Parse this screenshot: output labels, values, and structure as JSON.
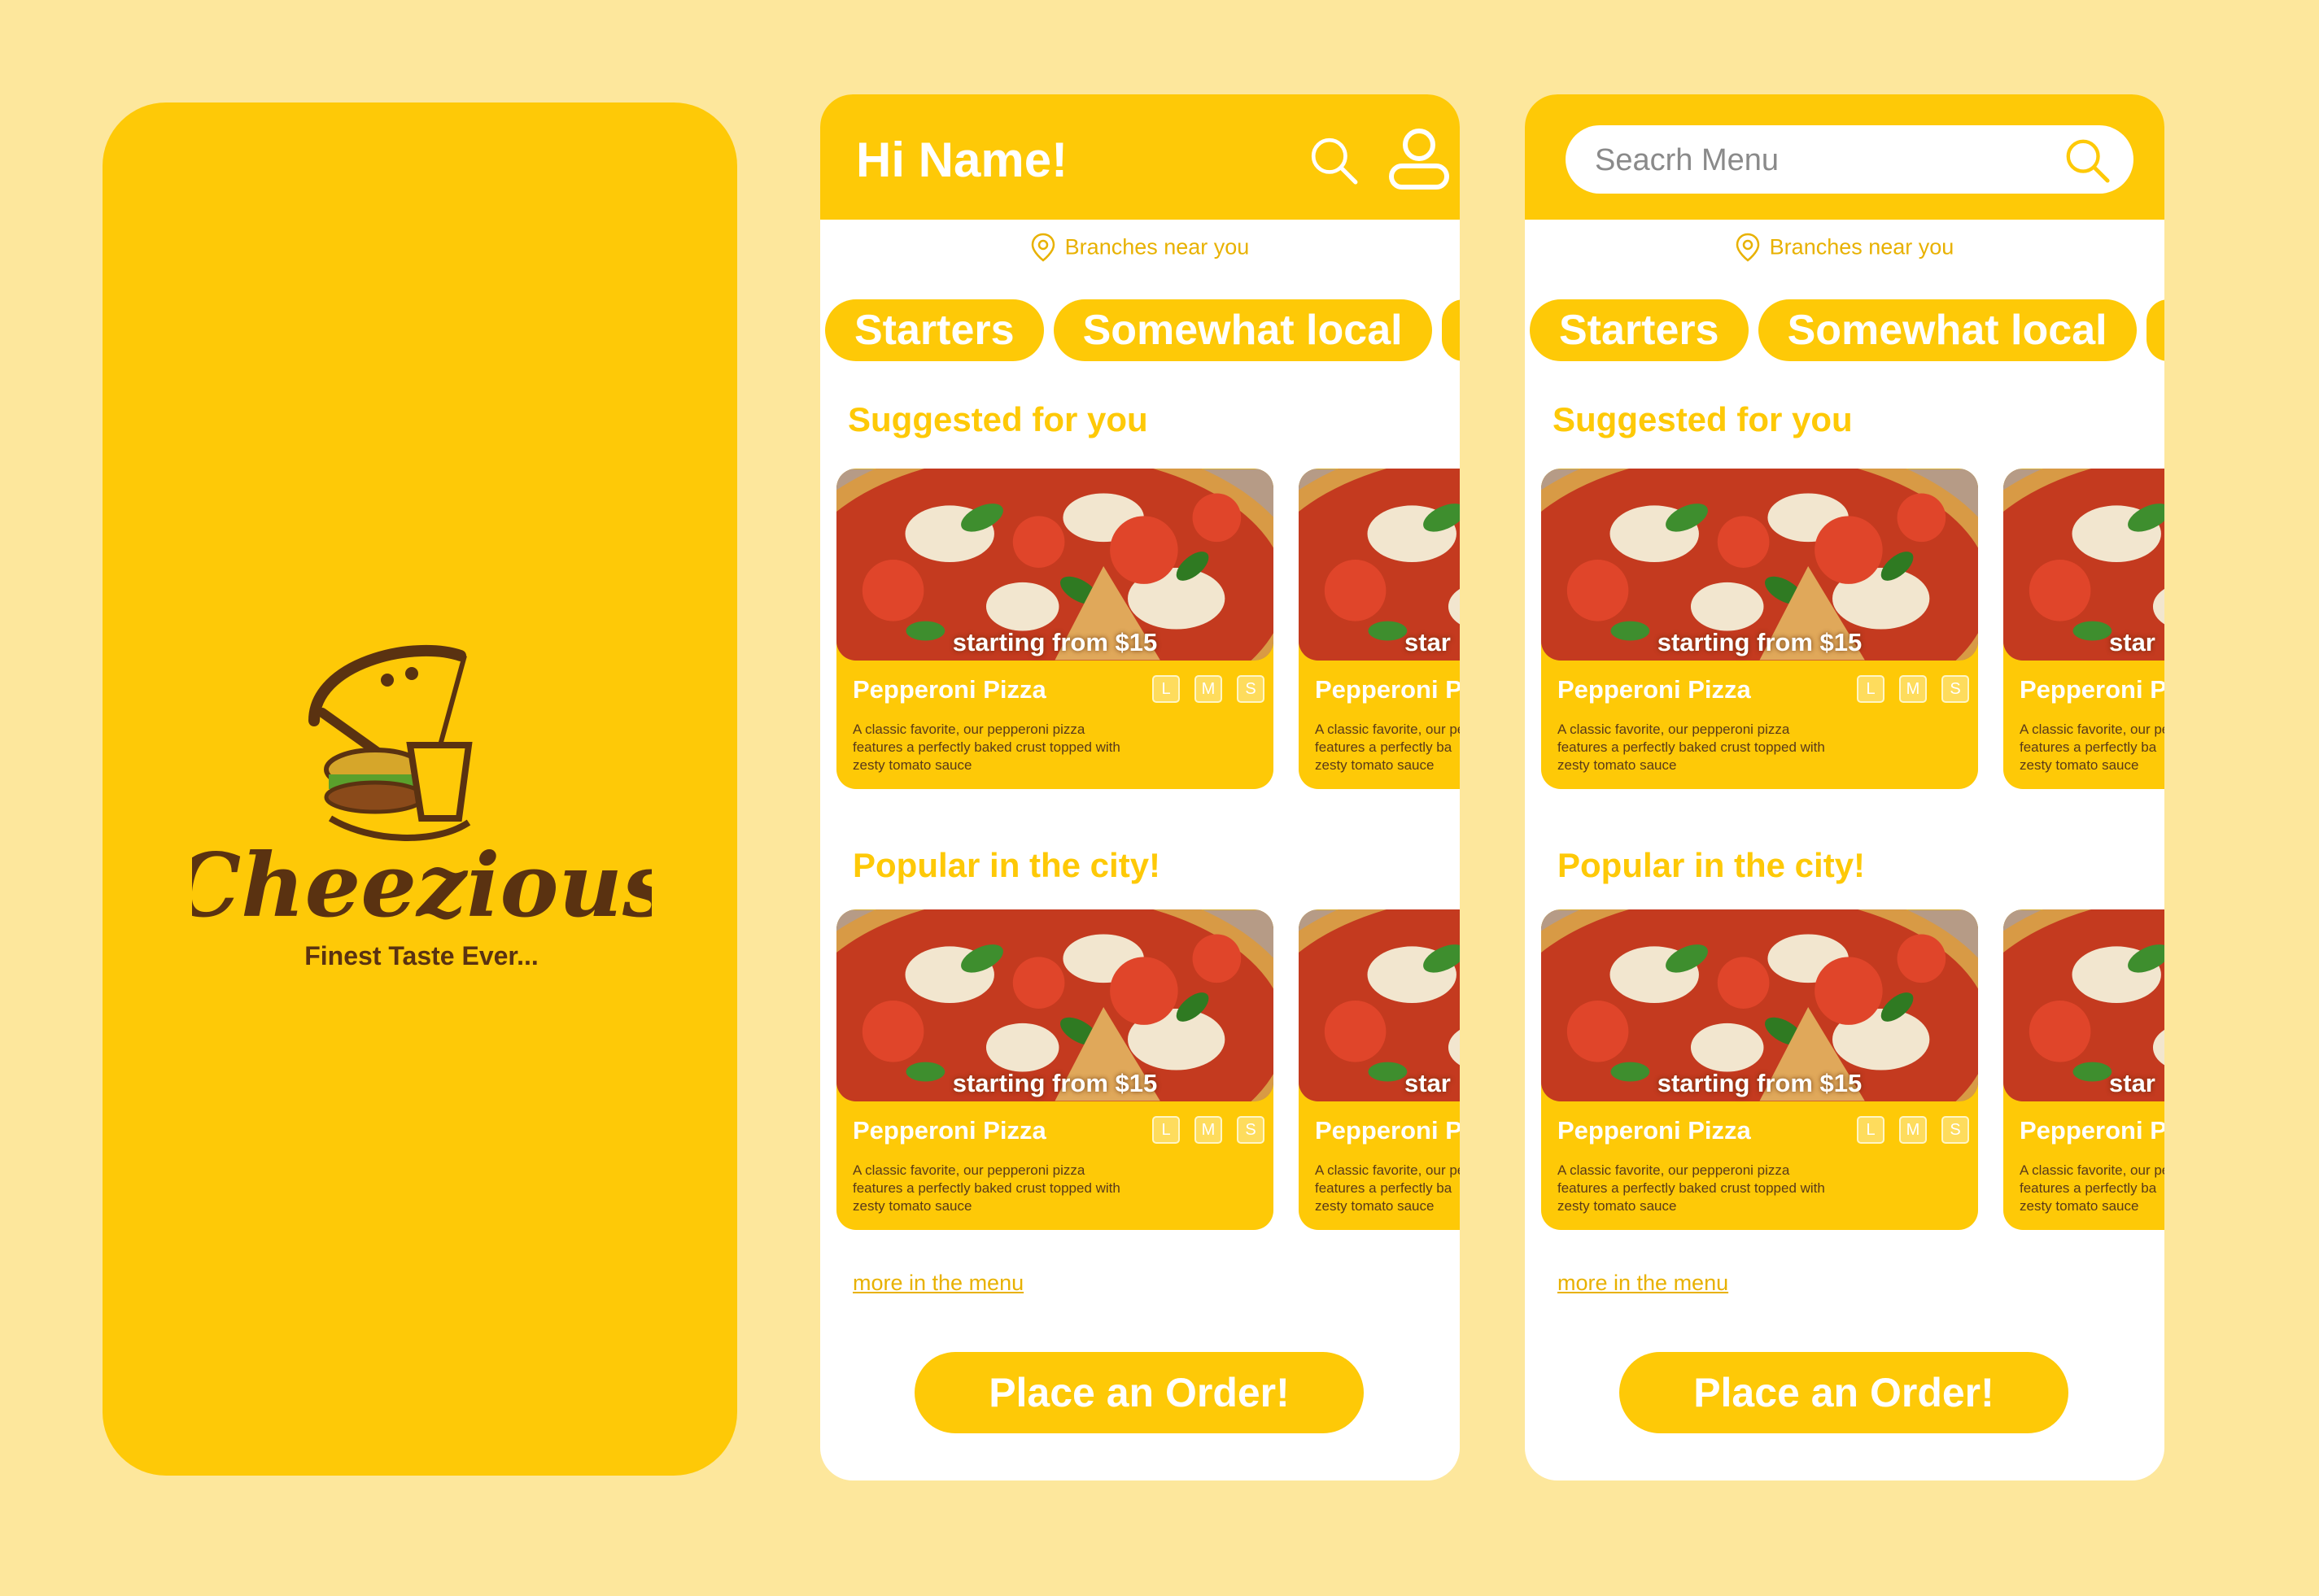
{
  "colors": {
    "background": "#fde79c",
    "brand_yellow": "#fec907",
    "brand_brown": "#5a3211",
    "white": "#ffffff"
  },
  "splash": {
    "logo_name": "Cheezious",
    "tagline": "Finest Taste Ever..."
  },
  "home": {
    "greeting": "Hi Name!",
    "search_icon": "search-icon",
    "profile_icon": "user-icon"
  },
  "search_screen": {
    "search_placeholder": "Seacrh Menu",
    "search_icon": "search-icon"
  },
  "branches": {
    "label": "Branches near you",
    "icon": "location-pin-icon"
  },
  "categories": [
    "Starters",
    "Somewhat local"
  ],
  "sections": {
    "suggested_title": "Suggested for you",
    "popular_title": "Popular in the city!"
  },
  "product": {
    "promo": "starting from $15",
    "promo_partial": "star",
    "name": "Pepperoni Pizza",
    "name_partial": "Pepperoni P",
    "sizes": [
      "L",
      "M",
      "S"
    ],
    "desc_line1": "A classic favorite, our pepperoni pizza",
    "desc_line2": "features a perfectly baked crust topped with",
    "desc_line3": "zesty tomato sauce",
    "desc_partial_line1": "A classic favorite, our pe",
    "desc_partial_line2": "features a perfectly ba",
    "desc_partial_line3": "zesty tomato sauce"
  },
  "footer": {
    "more_link": "more in the menu",
    "order_button": "Place an Order!"
  }
}
